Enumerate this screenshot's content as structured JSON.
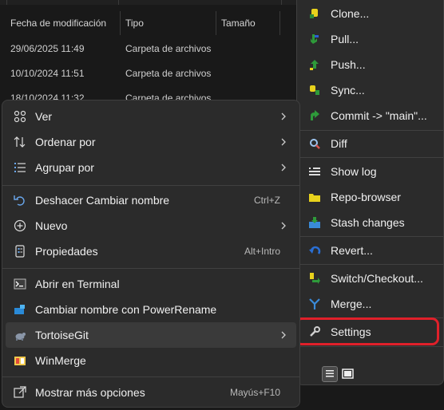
{
  "explorer": {
    "columns": [
      "Fecha de modificación",
      "Tipo",
      "Tamaño"
    ],
    "rows": [
      {
        "date": "29/06/2025 11:49",
        "type": "Carpeta de archivos"
      },
      {
        "date": "10/10/2024 11:51",
        "type": "Carpeta de archivos"
      },
      {
        "date": "18/10/2024 11:32",
        "type": "Carpeta de archivos"
      }
    ]
  },
  "menu": {
    "items": [
      {
        "label": "Ver",
        "icon": "grid-icon"
      },
      {
        "label": "Ordenar por",
        "icon": "sort-icon"
      },
      {
        "label": "Agrupar por",
        "icon": "group-icon"
      },
      {
        "label": "Deshacer Cambiar nombre",
        "shortcut": "Ctrl+Z",
        "icon": "undo-icon"
      },
      {
        "label": "Nuevo",
        "icon": "plus-icon"
      },
      {
        "label": "Propiedades",
        "shortcut": "Alt+Intro",
        "icon": "properties-icon"
      },
      {
        "label": "Abrir en Terminal",
        "icon": "terminal-icon"
      },
      {
        "label": "Cambiar nombre con PowerRename",
        "icon": "powerrename-icon"
      },
      {
        "label": "TortoiseGit",
        "icon": "tortoisegit-icon"
      },
      {
        "label": "WinMerge",
        "icon": "winmerge-icon"
      },
      {
        "label": "Mostrar más opciones",
        "shortcut": "Mayús+F10",
        "icon": "more-options-icon"
      }
    ]
  },
  "submenu": {
    "items": [
      {
        "label": "Clone...",
        "icon": "clone-icon"
      },
      {
        "label": "Pull...",
        "icon": "pull-icon"
      },
      {
        "label": "Push...",
        "icon": "push-icon"
      },
      {
        "label": "Sync...",
        "icon": "sync-icon"
      },
      {
        "label": "Commit -> \"main\"...",
        "icon": "commit-icon"
      },
      {
        "label": "Diff",
        "icon": "diff-icon"
      },
      {
        "label": "Show log",
        "icon": "log-icon"
      },
      {
        "label": "Repo-browser",
        "icon": "repo-browser-icon"
      },
      {
        "label": "Stash changes",
        "icon": "stash-icon"
      },
      {
        "label": "Revert...",
        "icon": "revert-icon"
      },
      {
        "label": "Switch/Checkout...",
        "icon": "switch-icon"
      },
      {
        "label": "Merge...",
        "icon": "merge-icon"
      },
      {
        "label": "Settings",
        "icon": "wrench-icon"
      }
    ]
  },
  "colors": {
    "menu_bg": "#2b2b2b",
    "highlight_outline": "#e0202a",
    "hover_bg": "#3a3a3a"
  }
}
